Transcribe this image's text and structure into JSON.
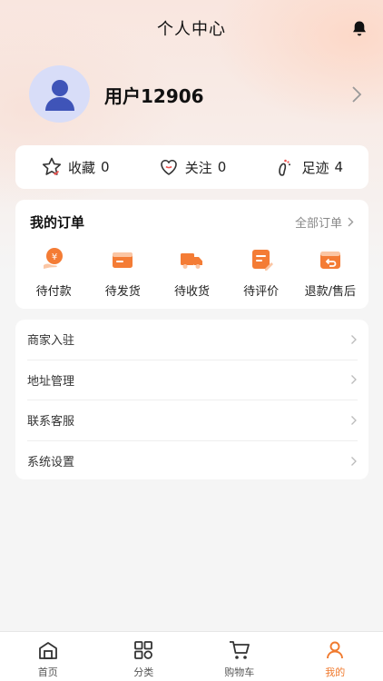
{
  "header": {
    "title": "个人中心",
    "bell_icon": "bell-icon"
  },
  "profile": {
    "username": "用户12906",
    "avatar_icon": "user-avatar-icon",
    "arrow_icon": "chevron-right-icon"
  },
  "stats": [
    {
      "label": "收藏",
      "count": "0",
      "icon": "star-icon"
    },
    {
      "label": "关注",
      "count": "0",
      "icon": "heart-icon"
    },
    {
      "label": "足迹",
      "count": "4",
      "icon": "footprint-icon"
    }
  ],
  "orders": {
    "title": "我的订单",
    "all_label": "全部订单",
    "accent": "#f47c35",
    "items": [
      {
        "label": "待付款",
        "icon": "payment-icon"
      },
      {
        "label": "待发货",
        "icon": "package-icon"
      },
      {
        "label": "待收货",
        "icon": "truck-icon"
      },
      {
        "label": "待评价",
        "icon": "review-icon"
      },
      {
        "label": "退款/售后",
        "icon": "refund-icon"
      }
    ]
  },
  "menu": [
    {
      "label": "商家入驻"
    },
    {
      "label": "地址管理"
    },
    {
      "label": "联系客服"
    },
    {
      "label": "系统设置"
    }
  ],
  "tabbar": [
    {
      "label": "首页",
      "icon": "home-icon",
      "active": false
    },
    {
      "label": "分类",
      "icon": "category-icon",
      "active": false
    },
    {
      "label": "购物车",
      "icon": "cart-icon",
      "active": false
    },
    {
      "label": "我的",
      "icon": "profile-icon",
      "active": true
    }
  ]
}
